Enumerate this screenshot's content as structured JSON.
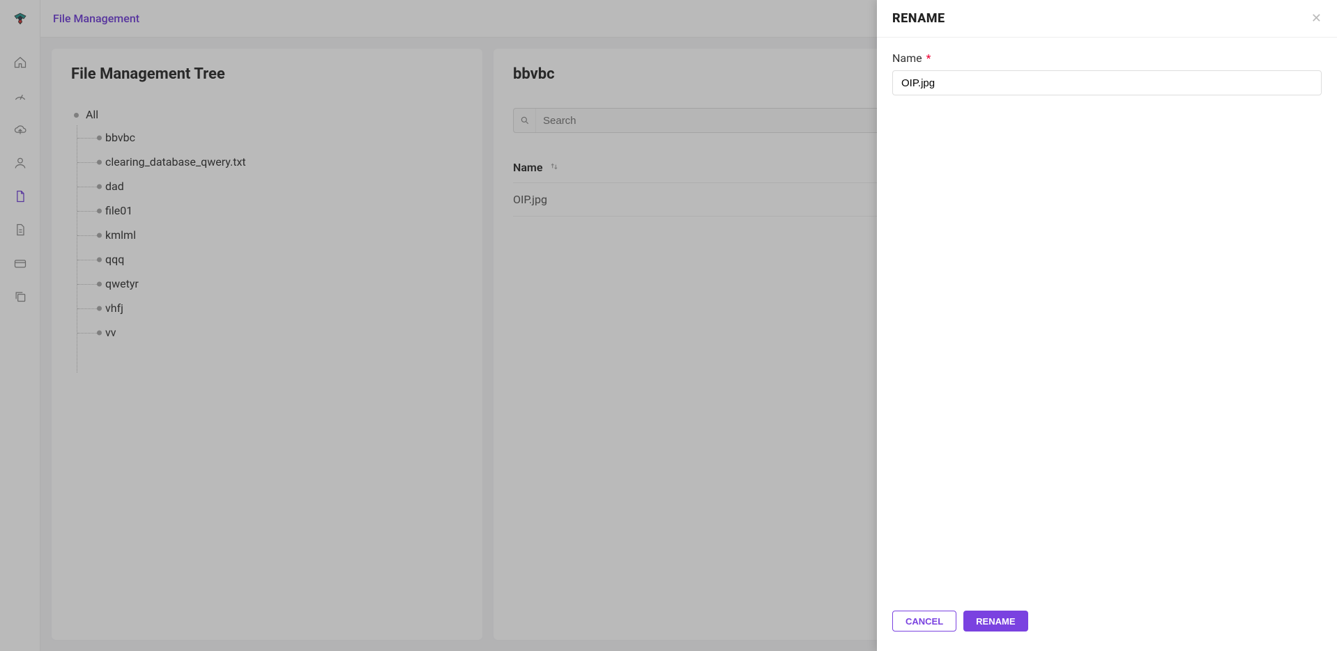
{
  "header": {
    "page_title": "File Management"
  },
  "left_panel": {
    "title": "File Management Tree",
    "root_label": "All",
    "items": [
      {
        "label": "bbvbc"
      },
      {
        "label": "clearing_database_qwery.txt"
      },
      {
        "label": "dad"
      },
      {
        "label": "file01"
      },
      {
        "label": "kmlml"
      },
      {
        "label": "qqq"
      },
      {
        "label": "qwetyr"
      },
      {
        "label": "vhfj"
      },
      {
        "label": "vv"
      }
    ]
  },
  "right_panel": {
    "title": "bbvbc",
    "search_placeholder": "Search",
    "column_name": "Name",
    "rows": [
      {
        "name": "OIP.jpg"
      }
    ]
  },
  "drawer": {
    "title": "RENAME",
    "field_label": "Name",
    "field_value": "OIP.jpg",
    "cancel_label": "CANCEL",
    "submit_label": "RENAME"
  }
}
